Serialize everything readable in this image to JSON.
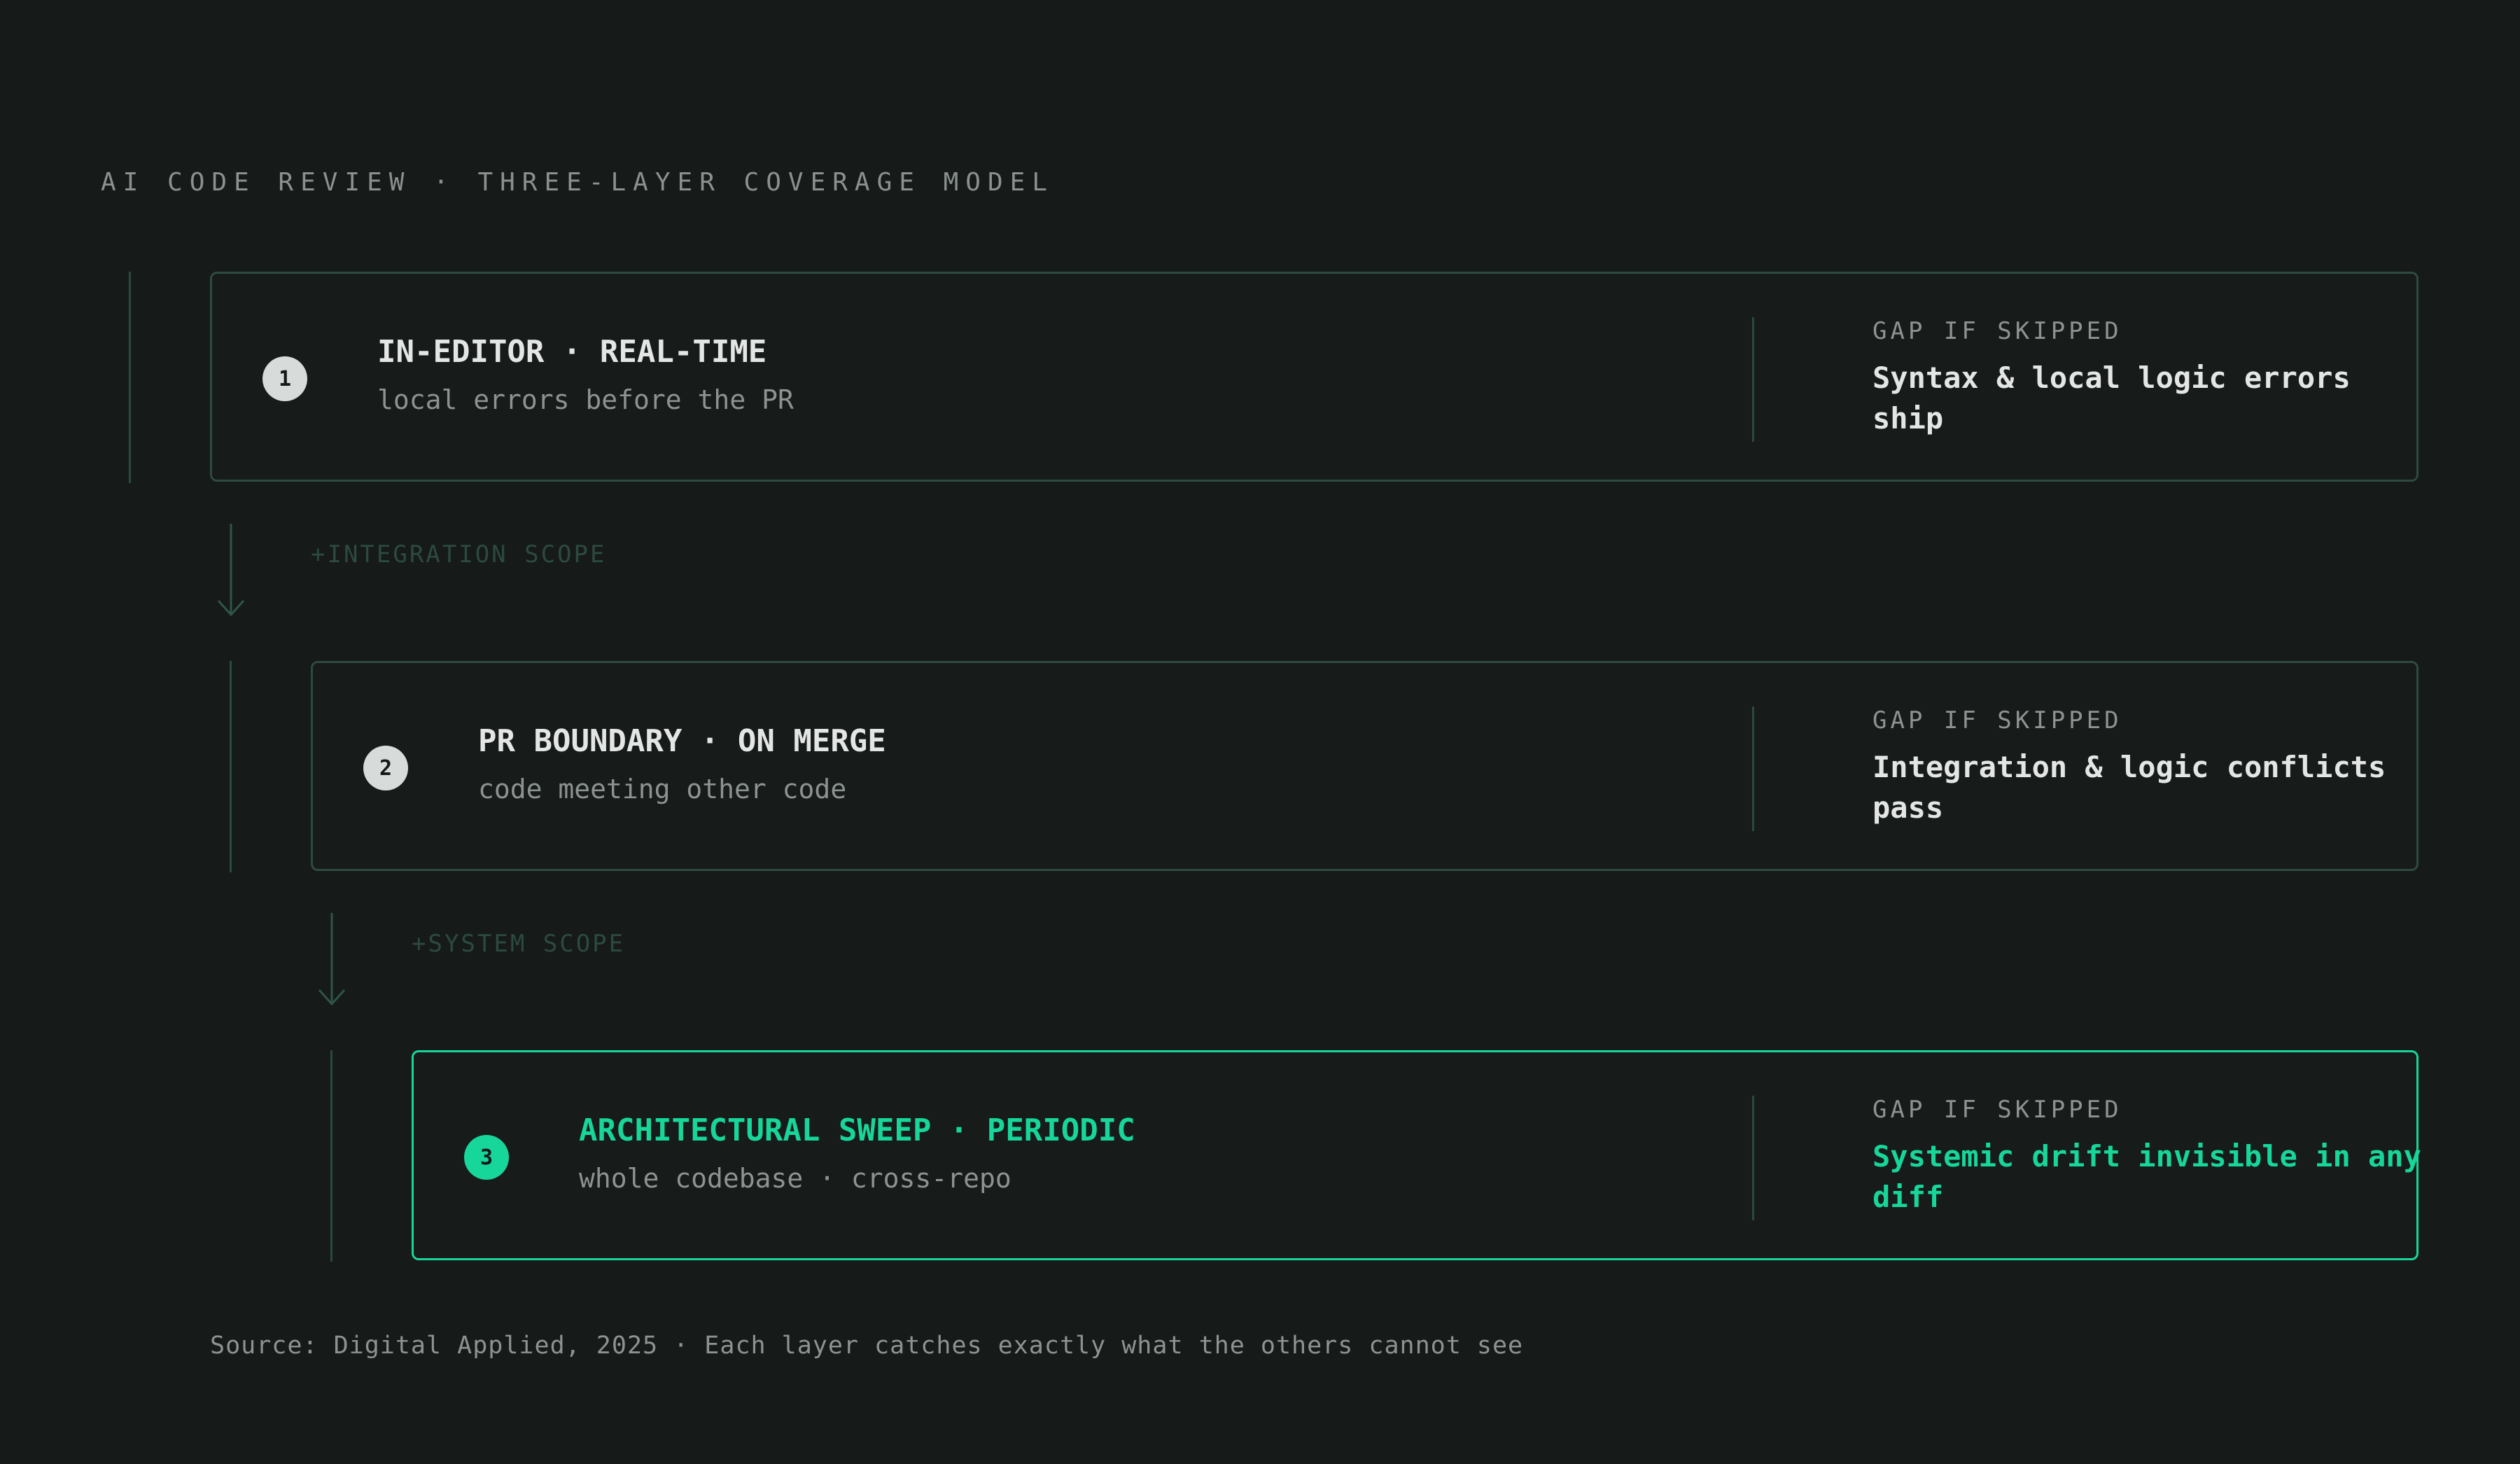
{
  "header": {
    "title": "AI CODE REVIEW · THREE-LAYER COVERAGE MODEL"
  },
  "layers": [
    {
      "number": "1",
      "title": "IN-EDITOR · REAL-TIME",
      "subtitle": "local errors before the PR",
      "gap_label": "GAP IF SKIPPED",
      "gap_text": "Syntax & local logic errors ship"
    },
    {
      "number": "2",
      "title": "PR BOUNDARY · ON MERGE",
      "subtitle": "code meeting other code",
      "gap_label": "GAP IF SKIPPED",
      "gap_text": "Integration & logic conflicts pass"
    },
    {
      "number": "3",
      "title": "ARCHITECTURAL SWEEP · PERIODIC",
      "subtitle": "whole codebase · cross-repo",
      "gap_label": "GAP IF SKIPPED",
      "gap_text": "Systemic drift invisible in any diff"
    }
  ],
  "connectors": [
    {
      "label": "+INTEGRATION SCOPE"
    },
    {
      "label": "+SYSTEM SCOPE"
    }
  ],
  "footer": {
    "source": "Source: Digital Applied, 2025 · Each layer catches exactly what the others cannot see"
  },
  "colors": {
    "background": "#161a19",
    "accent": "#17d69a",
    "border": "#2d4b40",
    "muted_text": "#8c9390"
  }
}
